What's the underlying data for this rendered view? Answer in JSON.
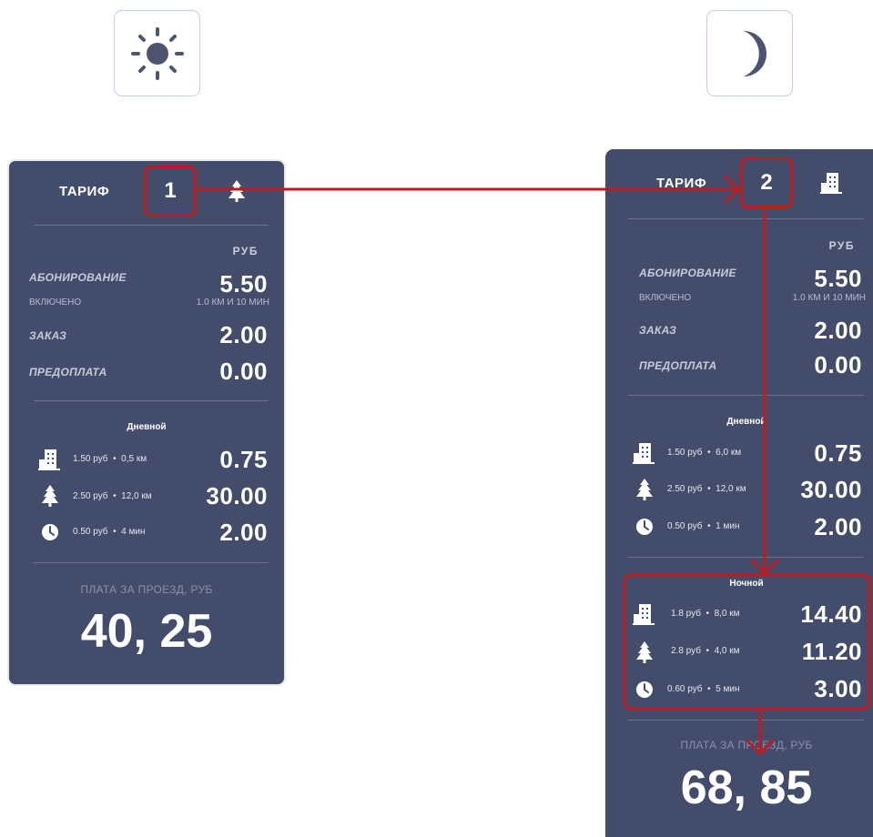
{
  "theme_buttons": {
    "day_icon": "sun-icon",
    "night_icon": "moon-icon"
  },
  "day": {
    "tariff_label": "ТАРИФ",
    "tariff_number": "1",
    "tariff_icon": "tree-icon",
    "currency": "РУБ",
    "subscription_label": "АБОНИРОВАНИЕ",
    "subscription_value": "5.50",
    "included_label": "ВКЛЮЧЕНО",
    "included_value": "1.0 КМ И 10 МИН",
    "order_label": "ЗАКАЗ",
    "order_value": "2.00",
    "prepay_label": "ПРЕДОПЛАТА",
    "prepay_value": "0.00",
    "section_title": "Дневной",
    "rows": [
      {
        "icon": "building-icon",
        "rate": "1.50 руб",
        "amount": "0,5 км",
        "value": "0.75"
      },
      {
        "icon": "tree-icon",
        "rate": "2.50 руб",
        "amount": "12,0 км",
        "value": "30.00"
      },
      {
        "icon": "clock-icon",
        "rate": "0.50 руб",
        "amount": "4 мин",
        "value": "2.00"
      }
    ],
    "fare_label": "ПЛАТА ЗА ПРОЕЗД, РУБ",
    "total": "40, 25"
  },
  "night": {
    "tariff_label": "ТАРИФ",
    "tariff_number": "2",
    "tariff_icon": "building-icon",
    "currency": "РУБ",
    "subscription_label": "АБОНИРОВАНИЕ",
    "subscription_value": "5.50",
    "included_label": "ВКЛЮЧЕНО",
    "included_value": "1.0 КМ И 10 МИН",
    "order_label": "ЗАКАЗ",
    "order_value": "2.00",
    "prepay_label": "ПРЕДОПЛАТА",
    "prepay_value": "0.00",
    "day_section_title": "Дневной",
    "day_rows": [
      {
        "icon": "building-icon",
        "rate": "1.50 руб",
        "amount": "6,0 км",
        "value": "0.75"
      },
      {
        "icon": "tree-icon",
        "rate": "2.50 руб",
        "amount": "12,0 км",
        "value": "30.00"
      },
      {
        "icon": "clock-icon",
        "rate": "0.50 руб",
        "amount": "1 мин",
        "value": "2.00"
      }
    ],
    "night_section_title": "Ночной",
    "night_rows": [
      {
        "icon": "building-icon",
        "rate": "1.8 руб",
        "amount": "8,0 км",
        "value": "14.40"
      },
      {
        "icon": "tree-icon",
        "rate": "2.8 руб",
        "amount": "4,0 км",
        "value": "11.20"
      },
      {
        "icon": "clock-icon",
        "rate": "0.60 руб",
        "amount": "5 мин",
        "value": "3.00"
      }
    ],
    "fare_label": "ПЛАТА ЗА ПРОЕЗД, РУБ",
    "total": "68, 85"
  },
  "colors": {
    "panel": "#444c6b",
    "highlight": "#c01a1f",
    "button_border": "#c4cff0",
    "sun": "#4e5470"
  }
}
